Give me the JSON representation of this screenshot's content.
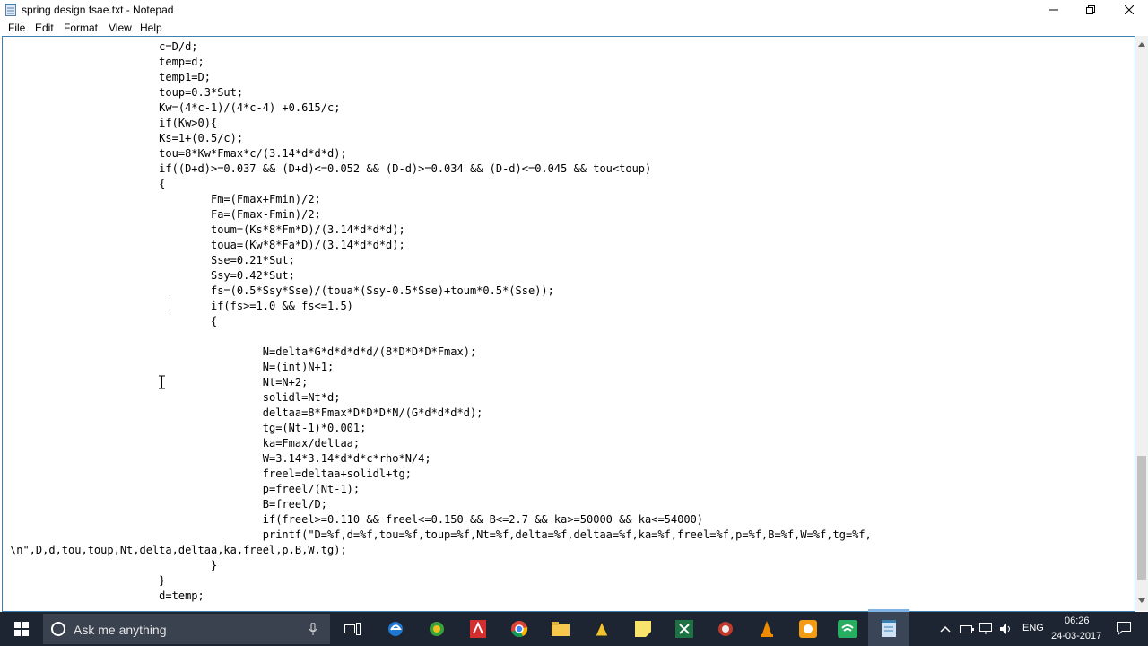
{
  "window": {
    "title": "spring design fsae.txt - Notepad"
  },
  "menu": {
    "file": "File",
    "edit": "Edit",
    "format": "Format",
    "view": "View",
    "help": "Help"
  },
  "editor": {
    "content": "                       c=D/d;\n                       temp=d;\n                       temp1=D;\n                       toup=0.3*Sut;\n                       Kw=(4*c-1)/(4*c-4) +0.615/c;\n                       if(Kw>0){\n                       Ks=1+(0.5/c);\n                       tou=8*Kw*Fmax*c/(3.14*d*d*d);\n                       if((D+d)>=0.037 && (D+d)<=0.052 && (D-d)>=0.034 && (D-d)<=0.045 && tou<toup)\n                       {\n                               Fm=(Fmax+Fmin)/2;\n                               Fa=(Fmax-Fmin)/2;\n                               toum=(Ks*8*Fm*D)/(3.14*d*d*d);\n                               toua=(Kw*8*Fa*D)/(3.14*d*d*d);\n                               Sse=0.21*Sut;\n                               Ssy=0.42*Sut;\n                               fs=(0.5*Ssy*Sse)/(toua*(Ssy-0.5*Sse)+toum*0.5*(Sse));\n                               if(fs>=1.0 && fs<=1.5)\n                               {\n\n                                       N=delta*G*d*d*d*d/(8*D*D*D*Fmax);\n                                       N=(int)N+1;\n                                       Nt=N+2;\n                                       solidl=Nt*d;\n                                       deltaa=8*Fmax*D*D*D*N/(G*d*d*d*d);\n                                       tg=(Nt-1)*0.001;\n                                       ka=Fmax/deltaa;\n                                       W=3.14*3.14*d*d*c*rho*N/4;\n                                       freel=deltaa+solidl+tg;\n                                       p=freel/(Nt-1);\n                                       B=freel/D;\n                                       if(freel>=0.110 && freel<=0.150 && B<=2.7 && ka>=50000 && ka<=54000)\n                                       printf(\"D=%f,d=%f,tou=%f,toup=%f,Nt=%f,delta=%f,deltaa=%f,ka=%f,freel=%f,p=%f,B=%f,W=%f,tg=%f,\n\\n\",D,d,tou,toup,Nt,delta,deltaa,ka,freel,p,B,W,tg);\n                               }\n                       }\n                       d=temp;"
  },
  "taskbar": {
    "search_placeholder": "Ask me anything",
    "language": "ENG",
    "time": "06:26",
    "date": "24-03-2017"
  }
}
